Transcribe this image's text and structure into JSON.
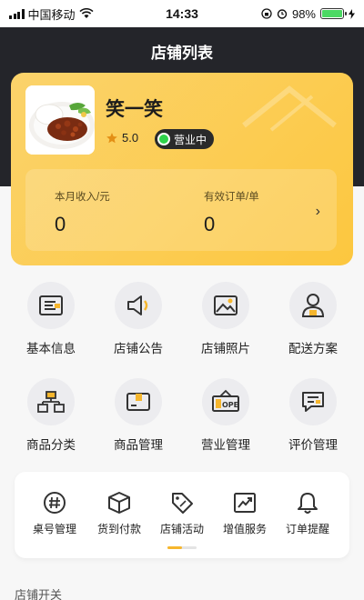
{
  "status_bar": {
    "carrier": "中国移动",
    "time": "14:33",
    "battery": "98%",
    "battery_level": 0.98
  },
  "header": {
    "title": "店铺列表"
  },
  "shop": {
    "name": "笑一笑",
    "rating": "5.0",
    "status": "营业中",
    "stats": [
      {
        "label": "本月收入/元",
        "value": "0"
      },
      {
        "label": "有效订单/单",
        "value": "0"
      }
    ],
    "arrow": "›"
  },
  "functions": [
    {
      "label": "基本信息",
      "icon": "info-card-icon"
    },
    {
      "label": "店铺公告",
      "icon": "speaker-icon"
    },
    {
      "label": "店铺照片",
      "icon": "photo-icon"
    },
    {
      "label": "配送方案",
      "icon": "courier-icon"
    },
    {
      "label": "商品分类",
      "icon": "category-icon"
    },
    {
      "label": "商品管理",
      "icon": "goods-icon"
    },
    {
      "label": "营业管理",
      "icon": "open-sign-icon"
    },
    {
      "label": "评价管理",
      "icon": "review-icon"
    }
  ],
  "services": [
    {
      "label": "桌号管理",
      "icon": "hash-icon"
    },
    {
      "label": "货到付款",
      "icon": "box-icon"
    },
    {
      "label": "店铺活动",
      "icon": "coupon-icon"
    },
    {
      "label": "增值服务",
      "icon": "trend-icon"
    },
    {
      "label": "订单提醒",
      "icon": "bell-icon"
    }
  ],
  "open_pill": "OPEN",
  "section_label": "店铺开关",
  "colors": {
    "accent": "#fcc73f",
    "header_bg": "#24252a",
    "status_green": "#2fd34b"
  }
}
